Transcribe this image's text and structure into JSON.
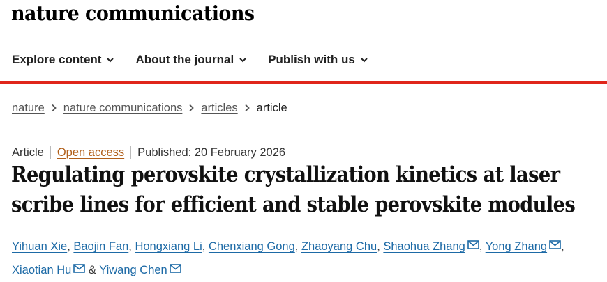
{
  "site": {
    "logo": "nature communications"
  },
  "nav": {
    "items": [
      {
        "label": "Explore content",
        "icon": "chevron-down-icon"
      },
      {
        "label": "About the journal",
        "icon": "chevron-down-icon"
      },
      {
        "label": "Publish with us",
        "icon": "chevron-down-icon"
      }
    ]
  },
  "breadcrumb": {
    "items": [
      "nature",
      "nature communications",
      "articles"
    ],
    "current": "article"
  },
  "article": {
    "type": "Article",
    "access": "Open access",
    "published": "Published: 20 February 2026",
    "title_line1": "Regulating perovskite crystallization kinetics at laser",
    "title_line2": "scribe lines for efficient and stable perovskite modules"
  },
  "authors": {
    "list": [
      "Yihuan Xie",
      "Baojin Fan",
      "Hongxiang Li",
      "Chenxiang Gong",
      "Zhaoyang Chu",
      "Shaohua Zhang",
      "Yong Zhang",
      "Xiaotian Hu",
      "Yiwang Chen"
    ],
    "separator": ", ",
    "last_separator": " & ",
    "corresponding_icon": "mail-icon"
  },
  "colors": {
    "accent_red": "#e0261b",
    "link_blue": "#1d6aa6",
    "open_access_orange": "#b15f1a"
  }
}
